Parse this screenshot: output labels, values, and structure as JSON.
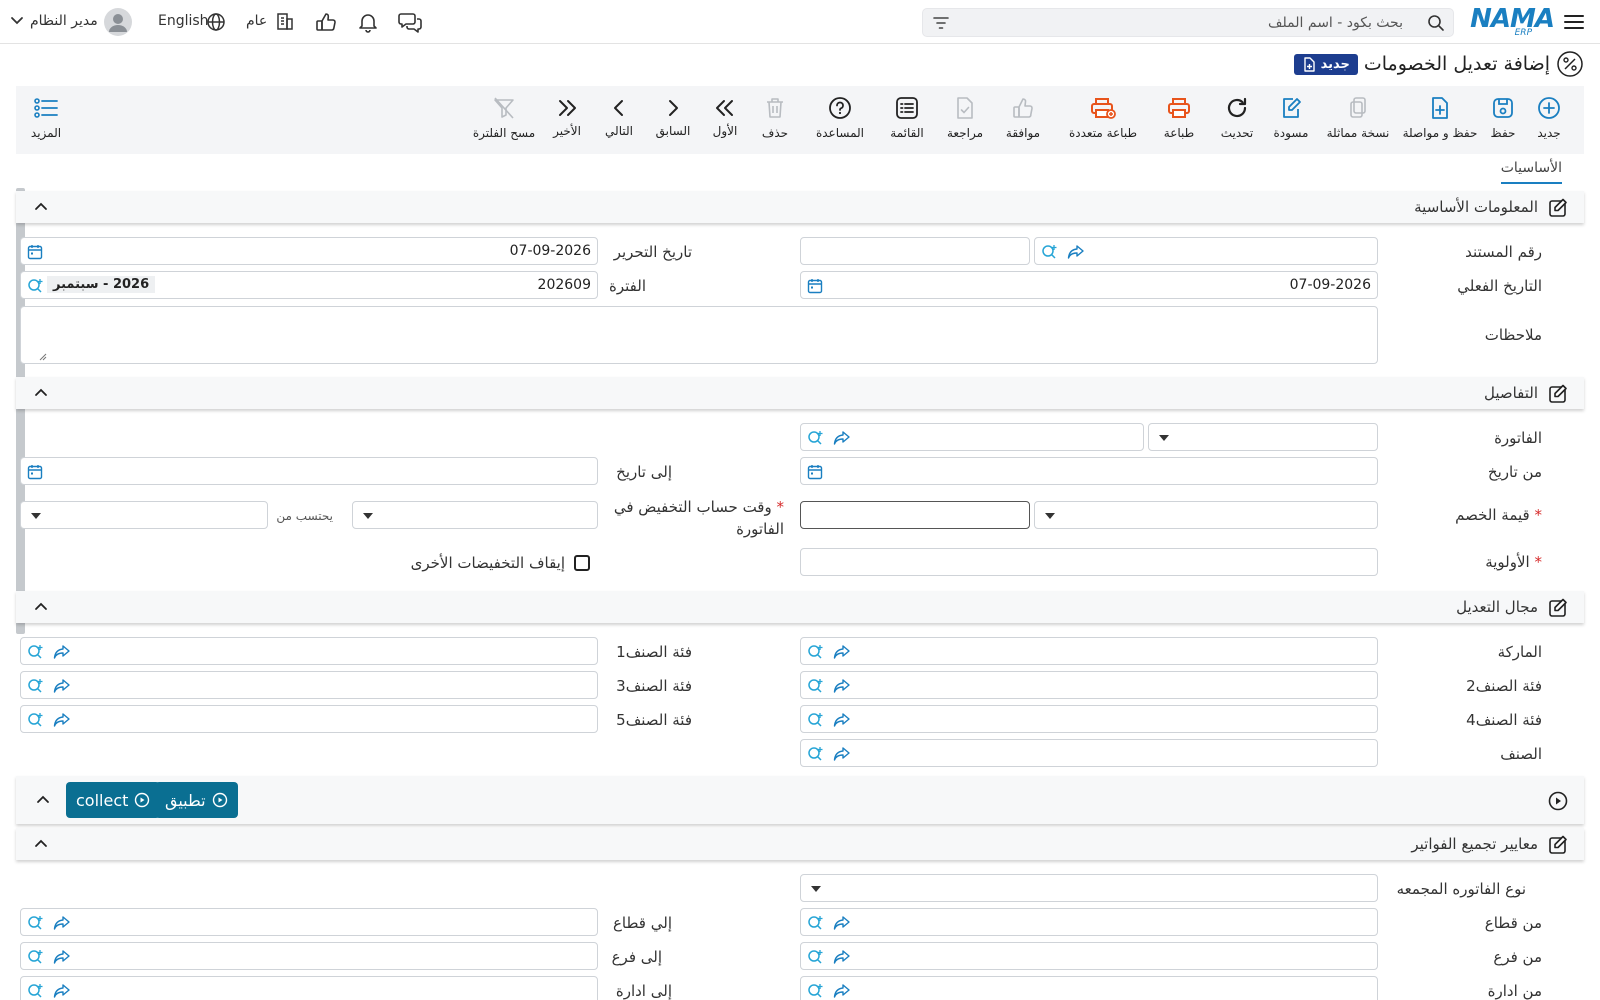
{
  "topbar": {
    "search_placeholder": "بحث بكود - اسم الملف",
    "logo_main": "NAMA",
    "logo_sub": "ERP",
    "user_label": "مدير النظام",
    "language_label": "English",
    "branch_label": "عام"
  },
  "page": {
    "title": "إضافة تعديل الخصومات",
    "new_badge": "جديد",
    "tab_basics": "الأساسيات"
  },
  "toolbar": {
    "new": "جديد",
    "save": "حفظ",
    "save_continue": "حفظ و مواصلة",
    "duplicate": "نسخة مماثلة",
    "draft": "مسودة",
    "refresh": "تحديث",
    "print": "طباعة",
    "multi_print": "طباعة متعددة",
    "approve": "موافقة",
    "review": "مراجعة",
    "list": "القائمة",
    "help": "المساعدة",
    "delete": "حذف",
    "first": "الأول",
    "previous": "السابق",
    "next": "التالي",
    "last": "الأخير",
    "clear_filter": "مسح الفلترة",
    "more": "المزيد"
  },
  "colors": {
    "accent": "#1a7fc1",
    "badge": "#1d3d8f",
    "print_orange": "#e8541c",
    "action_button": "#0a6f92"
  },
  "basic_info": {
    "title": "المعلومات الأساسية",
    "doc_number_label": "رقم المستند",
    "edit_date_label": "تاريخ التحرير",
    "edit_date_value": "07-09-2026",
    "actual_date_label": "التاريخ الفعلي",
    "actual_date_value": "07-09-2026",
    "period_label": "الفترة",
    "period_value": "202609",
    "period_name": "2026 - سبتمبر",
    "notes_label": "ملاحظات"
  },
  "details": {
    "title": "التفاصيل",
    "invoice_label": "الفاتورة",
    "from_date_label": "من تاريخ",
    "to_date_label": "إلى تاريخ",
    "discount_value_label": "قيمة الخصم",
    "discount_time_label_line1": "وقت حساب التخفيض في",
    "discount_time_label_line2": "الفاتورة",
    "calc_from_label": "يحتسب من",
    "priority_label": "الأولوية",
    "stop_other_label": "إيقاف التخفيضات الأخرى"
  },
  "scope": {
    "title": "مجال التعديل",
    "brand_label": "الماركة",
    "cat1_label": "فئة الصنف1",
    "cat2_label": "فئة الصنف2",
    "cat3_label": "فئة الصنف3",
    "cat4_label": "فئة الصنف4",
    "cat5_label": "فئة الصنف5",
    "item_label": "الصنف"
  },
  "actions": {
    "apply_label": "تطبيق",
    "collect_label": "collect"
  },
  "grouping": {
    "title": "معايير تجميع الفواتير",
    "type_label": "نوع الفاتوره المجمعه",
    "from_sector_label": "من قطاع",
    "to_sector_label": "إلي قطاع",
    "from_branch_label": "من فرع",
    "to_branch_label": "إلى فرع",
    "from_dept_label": "من ادارة",
    "to_dept_label": "إلى ادارة"
  }
}
